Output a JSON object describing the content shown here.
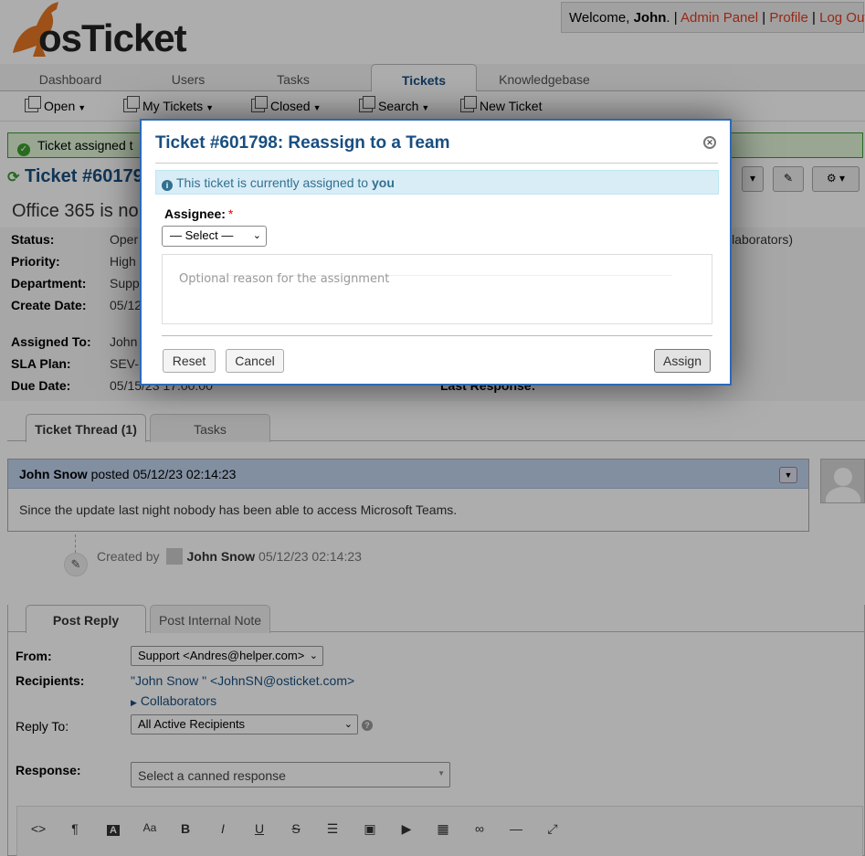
{
  "header": {
    "brand": "osTicket",
    "welcome_prefix": "Welcome, ",
    "user_name": "John",
    "welcome_suffix": ".",
    "links": [
      "Admin Panel",
      "Profile",
      "Log Out"
    ]
  },
  "nav": {
    "tabs": [
      "Dashboard",
      "Users",
      "Tasks",
      "Tickets",
      "Knowledgebase"
    ],
    "active": "Tickets"
  },
  "subnav": [
    "Open",
    "My Tickets",
    "Closed",
    "Search",
    "New Ticket"
  ],
  "notice": {
    "text": "Ticket assigned t"
  },
  "ticket": {
    "title": "Ticket #60179",
    "subject": "Office 365 is no",
    "fields": [
      {
        "label": "Status:",
        "value": "Oper"
      },
      {
        "label": "Priority:",
        "value": "High"
      },
      {
        "label": "Department:",
        "value": "Supp"
      },
      {
        "label": "Create Date:",
        "value": "05/12"
      }
    ],
    "fields2": [
      {
        "label": "Assigned To:",
        "value": "John"
      },
      {
        "label": "SLA Plan:",
        "value": "SEV-"
      },
      {
        "label": "Due Date:",
        "value": "05/15/23 17:00:00"
      }
    ],
    "collaborators_fragment": "llaborators)",
    "last_response_label": "Last Response:"
  },
  "thread": {
    "tabs": [
      "Ticket Thread (1)",
      "Tasks"
    ],
    "message": {
      "author": "John Snow",
      "posted": "posted",
      "date": "05/12/23 02:14:23",
      "body": "Since the update last night nobody has been able to access Microsoft Teams."
    },
    "event": {
      "prefix": "Created by",
      "author": "John Snow",
      "date": "05/12/23 02:14:23"
    }
  },
  "reply": {
    "tabs": [
      "Post Reply",
      "Post Internal Note"
    ],
    "from_label": "From:",
    "from_value": "Support <Andres@helper.com>",
    "recipients_label": "Recipients:",
    "recipients_value": "\"John Snow \" <JohnSN@osticket.com>",
    "collaborators_link": "Collaborators",
    "reply_to_label": "Reply To:",
    "reply_to_value": "All Active Recipients",
    "response_label": "Response:",
    "canned_placeholder": "Select a canned response"
  },
  "dialog": {
    "title": "Ticket #601798: Reassign to a Team",
    "info_prefix": "This ticket is currently assigned to ",
    "info_bold": "you",
    "assignee_label": "Assignee:",
    "required_mark": "*",
    "select_value": "— Select —",
    "reason_placeholder": "Optional reason for the assignment",
    "buttons": {
      "reset": "Reset",
      "cancel": "Cancel",
      "assign": "Assign"
    }
  },
  "colors": {
    "brand_blue": "#184E81",
    "link_red": "#e03b1f",
    "dialog_border": "#2a6ab8",
    "info_bg": "#d9edf7",
    "thread_header": "#c0d3ee",
    "notice_green": "#3c9e2f"
  }
}
